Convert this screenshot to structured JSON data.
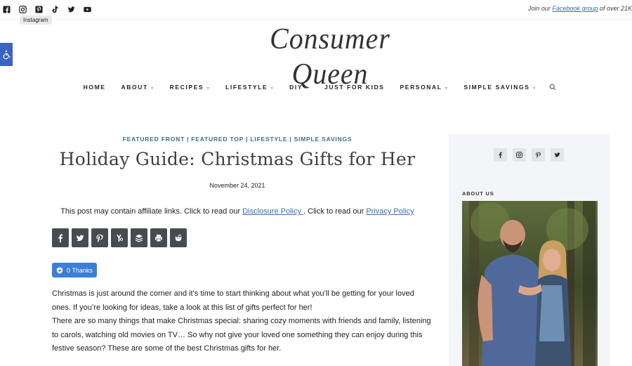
{
  "topbar": {
    "social": [
      {
        "name": "facebook-icon"
      },
      {
        "name": "instagram-icon"
      },
      {
        "name": "pinterest-icon"
      },
      {
        "name": "tiktok-icon"
      },
      {
        "name": "twitter-icon"
      },
      {
        "name": "youtube-icon"
      }
    ],
    "tooltip": "Instagram",
    "promo_prefix": "Join our ",
    "promo_link": "Facebook group",
    "promo_suffix": " of over 21K"
  },
  "logo": {
    "text": "Consumer Queen"
  },
  "nav": {
    "items": [
      {
        "label": "HOME",
        "dropdown": false
      },
      {
        "label": "ABOUT",
        "dropdown": true
      },
      {
        "label": "RECIPES",
        "dropdown": true
      },
      {
        "label": "LIFESTYLE",
        "dropdown": true
      },
      {
        "label": "DIY",
        "dropdown": true
      },
      {
        "label": "JUST FOR KIDS",
        "dropdown": false
      },
      {
        "label": "PERSONAL",
        "dropdown": true
      },
      {
        "label": "SIMPLE SAVINGS",
        "dropdown": true
      }
    ],
    "caret": "⌄"
  },
  "post": {
    "categories": [
      "FEATURED FRONT",
      "FEATURED TOP",
      "LIFESTYLE",
      "SIMPLE SAVINGS"
    ],
    "category_separator": "|",
    "title": "Holiday Guide: Christmas Gifts for Her",
    "date": "November 24, 2021",
    "affiliate": {
      "prefix": "This post may contain affiliate links. Click to read our ",
      "disclosure": "Disclosure Policy ",
      "middle": ". Click to read our ",
      "privacy": "Privacy Policy"
    },
    "share_buttons": [
      "facebook-share",
      "twitter-share",
      "pinterest-share",
      "yummly-share",
      "buffer-share",
      "print-share",
      "reddit-share"
    ],
    "thanks": "0 Thanks",
    "paragraphs": [
      "Christmas is just around the corner and it’s time to start thinking about what you’ll be getting for your loved ones. If you’re looking for ideas, take a look at this list of gifts perfect for her!",
      "There are so many things that make Christmas special: sharing cozy moments with friends and family, listening to carols, watching old movies on TV… So why not give your loved one something they can enjoy during this festive season? These are some of the best Christmas gifts for her."
    ]
  },
  "sidebar": {
    "social": [
      "facebook",
      "instagram",
      "pinterest",
      "twitter"
    ],
    "about_label": "ABOUT US"
  },
  "colors": {
    "accent": "#3e6d8e",
    "share_button": "#474b52",
    "thanks_button": "#3a7fd8",
    "a11y": "#3a64c4",
    "sidebar_bg": "#f3f5f8"
  }
}
